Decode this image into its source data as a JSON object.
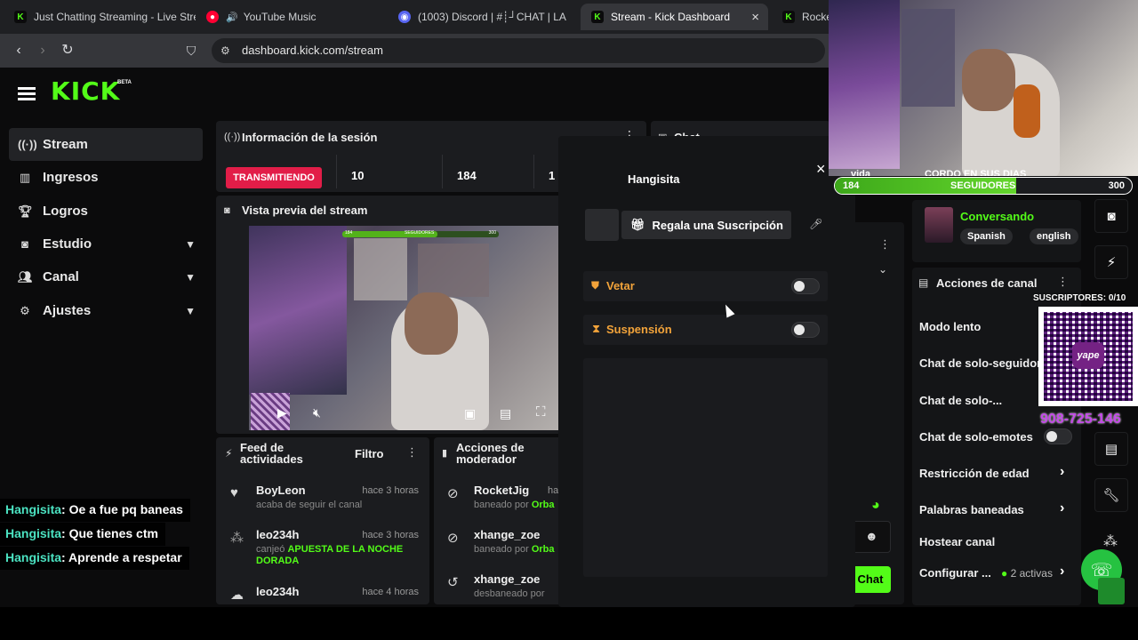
{
  "browser": {
    "tabs": [
      {
        "title": "Just Chatting Streaming - Live Stre",
        "icon": "kick-favicon"
      },
      {
        "title": "YouTube Music",
        "icon": "youtube-music-favicon"
      },
      {
        "title": "(1003) Discord | #┊┘CHAT | LA",
        "icon": "discord-favicon"
      },
      {
        "title": "Stream - Kick Dashboard",
        "icon": "kick-favicon"
      },
      {
        "title": "Rocket",
        "icon": "kick-favicon"
      }
    ],
    "close_glyph": "×",
    "url": "dashboard.kick.com/stream"
  },
  "brand": {
    "logo": "KICK",
    "beta": "BETA",
    "accent": "#53fc18"
  },
  "sidebar": {
    "items": [
      {
        "label": "Stream",
        "icon": "broadcast-icon"
      },
      {
        "label": "Ingresos",
        "icon": "chart-icon"
      },
      {
        "label": "Logros",
        "icon": "trophy-icon"
      },
      {
        "label": "Estudio",
        "icon": "camera-icon"
      },
      {
        "label": "Canal",
        "icon": "users-icon"
      },
      {
        "label": "Ajustes",
        "icon": "gear-icon"
      }
    ]
  },
  "session": {
    "title": "Información de la sesión",
    "status_badge": "TRANSMITIENDO",
    "stat1": "10",
    "stat2": "184",
    "stat3": "1"
  },
  "chat_header": "Chat",
  "preview": {
    "title": "Vista previa del stream",
    "bar_left": "184",
    "bar_label": "SEGUIDORES",
    "bar_right": "300"
  },
  "feed": {
    "title_line1": "Feed de",
    "title_line2": "actividades",
    "filter": "Filtro",
    "rows": [
      {
        "name": "BoyLeon",
        "time": "hace 3 horas",
        "text": "acaba de seguir el canal",
        "highlight": ""
      },
      {
        "name": "leo234h",
        "time": "hace 3 horas",
        "text": "canjeó",
        "highlight": "APUESTA DE LA NOCHE DORADA"
      },
      {
        "name": "leo234h",
        "time": "hace 4 horas",
        "text": "",
        "highlight": ""
      }
    ]
  },
  "mod_actions": {
    "title_line1": "Acciones de",
    "title_line2": "moderador",
    "rows": [
      {
        "name": "RocketJig",
        "time": "ha",
        "text": "baneado por",
        "by": "Orba"
      },
      {
        "name": "xhange_zoe",
        "time": "",
        "text": "baneado por",
        "by": "Orba"
      },
      {
        "name": "xhange_zoe",
        "time": "",
        "text": "desbaneado por",
        "by": ""
      }
    ]
  },
  "modal": {
    "username": "Hangisita",
    "gift_sub": "Regala una Suscripción",
    "ban": "Vetar",
    "timeout": "Suspensión"
  },
  "channel_info": {
    "category": "Conversando",
    "tags": [
      "Spanish",
      "english"
    ]
  },
  "channel_actions": {
    "title": "Acciones de canal",
    "items": [
      {
        "label": "Modo lento"
      },
      {
        "label": "Chat de solo-seguidores"
      },
      {
        "label": "Chat de solo-..."
      },
      {
        "label": "Chat de solo-emotes"
      },
      {
        "label": "Restricción de edad"
      },
      {
        "label": "Palabras baneadas"
      },
      {
        "label": "Hostear canal"
      },
      {
        "label": "Configurar ..."
      }
    ],
    "active_count": "2 activas"
  },
  "chat_send": "Chat",
  "overlay": {
    "followers_left": "184",
    "followers_label": "SEGUIDORES",
    "followers_right": "300",
    "webcam_caption_left": "vida",
    "webcam_caption_right": "CORDO EN SUS DIAS",
    "subscribers": "SUSCRIPTORES: 0/10",
    "phone": "908-725-146",
    "qr_label": "yape",
    "chat_messages": [
      {
        "user": "Hangisita",
        "text": ": Oe a fue pq baneas"
      },
      {
        "user": "Hangisita",
        "text": ": Que tienes ctm"
      },
      {
        "user": "Hangisita",
        "text": ": Aprende a respetar"
      }
    ]
  }
}
